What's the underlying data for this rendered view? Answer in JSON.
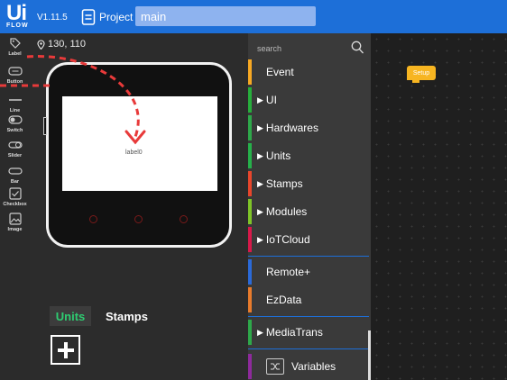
{
  "header": {
    "logo_text": "Ui",
    "logo_sub": "FLOW",
    "version": "V1.11.5",
    "project_label": "Project",
    "file_name": "main"
  },
  "components": [
    {
      "label": "Label",
      "icon": "tag-icon"
    },
    {
      "label": "Button",
      "icon": "button-icon"
    },
    {
      "label": "Line",
      "icon": "line-icon"
    },
    {
      "label": "Switch",
      "icon": "switch-icon"
    },
    {
      "label": "Slider",
      "icon": "slider-icon"
    },
    {
      "label": "Bar",
      "icon": "bar-icon"
    },
    {
      "label": "Checkbox",
      "icon": "checkbox-icon"
    },
    {
      "label": "Image",
      "icon": "image-icon"
    }
  ],
  "device": {
    "coords": "130, 110",
    "widget_label": "label0",
    "tabs": {
      "units": "Units",
      "stamps": "Stamps"
    }
  },
  "blocks": {
    "search_placeholder": "search",
    "categories": [
      {
        "label": "Event",
        "color": "#f7a823",
        "expandable": false
      },
      {
        "label": "UI",
        "color": "#27ae3c",
        "expandable": true
      },
      {
        "label": "Hardwares",
        "color": "#2ea84a",
        "expandable": true
      },
      {
        "label": "Units",
        "color": "#26b04a",
        "expandable": true
      },
      {
        "label": "Stamps",
        "color": "#e8462c",
        "expandable": true
      },
      {
        "label": "Modules",
        "color": "#7fc428",
        "expandable": true
      },
      {
        "label": "IoTCloud",
        "color": "#d8194a",
        "expandable": true
      },
      {
        "label": "Remote+",
        "color": "#2b6ad8",
        "expandable": false
      },
      {
        "label": "EzData",
        "color": "#e87b2c",
        "expandable": false
      },
      {
        "label": "MediaTrans",
        "color": "#2ea84a",
        "expandable": true
      },
      {
        "label": "Variables",
        "color": "#8e2a9c",
        "expandable": false
      }
    ]
  },
  "workspace": {
    "setup_label": "Setup",
    "setup_color": "#f7b521"
  },
  "colors": {
    "accent": "#1d6fd8",
    "drag_path": "#e83a3a"
  }
}
